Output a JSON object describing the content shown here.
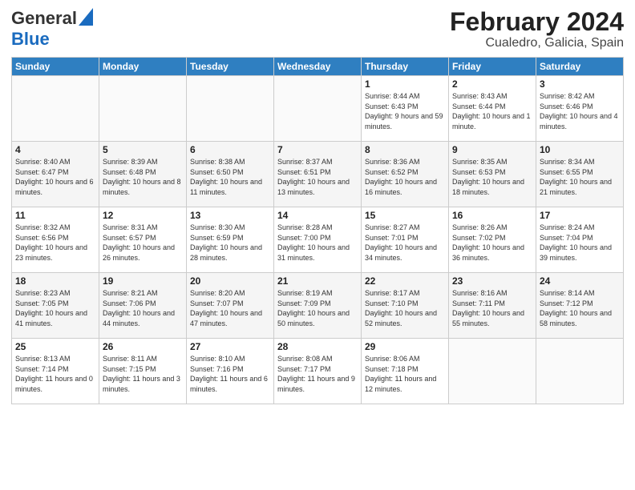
{
  "header": {
    "logo_general": "General",
    "logo_blue": "Blue",
    "month_title": "February 2024",
    "location": "Cualedro, Galicia, Spain"
  },
  "weekdays": [
    "Sunday",
    "Monday",
    "Tuesday",
    "Wednesday",
    "Thursday",
    "Friday",
    "Saturday"
  ],
  "weeks": [
    [
      {
        "day": "",
        "info": ""
      },
      {
        "day": "",
        "info": ""
      },
      {
        "day": "",
        "info": ""
      },
      {
        "day": "",
        "info": ""
      },
      {
        "day": "1",
        "info": "Sunrise: 8:44 AM\nSunset: 6:43 PM\nDaylight: 9 hours and 59 minutes."
      },
      {
        "day": "2",
        "info": "Sunrise: 8:43 AM\nSunset: 6:44 PM\nDaylight: 10 hours and 1 minute."
      },
      {
        "day": "3",
        "info": "Sunrise: 8:42 AM\nSunset: 6:46 PM\nDaylight: 10 hours and 4 minutes."
      }
    ],
    [
      {
        "day": "4",
        "info": "Sunrise: 8:40 AM\nSunset: 6:47 PM\nDaylight: 10 hours and 6 minutes."
      },
      {
        "day": "5",
        "info": "Sunrise: 8:39 AM\nSunset: 6:48 PM\nDaylight: 10 hours and 8 minutes."
      },
      {
        "day": "6",
        "info": "Sunrise: 8:38 AM\nSunset: 6:50 PM\nDaylight: 10 hours and 11 minutes."
      },
      {
        "day": "7",
        "info": "Sunrise: 8:37 AM\nSunset: 6:51 PM\nDaylight: 10 hours and 13 minutes."
      },
      {
        "day": "8",
        "info": "Sunrise: 8:36 AM\nSunset: 6:52 PM\nDaylight: 10 hours and 16 minutes."
      },
      {
        "day": "9",
        "info": "Sunrise: 8:35 AM\nSunset: 6:53 PM\nDaylight: 10 hours and 18 minutes."
      },
      {
        "day": "10",
        "info": "Sunrise: 8:34 AM\nSunset: 6:55 PM\nDaylight: 10 hours and 21 minutes."
      }
    ],
    [
      {
        "day": "11",
        "info": "Sunrise: 8:32 AM\nSunset: 6:56 PM\nDaylight: 10 hours and 23 minutes."
      },
      {
        "day": "12",
        "info": "Sunrise: 8:31 AM\nSunset: 6:57 PM\nDaylight: 10 hours and 26 minutes."
      },
      {
        "day": "13",
        "info": "Sunrise: 8:30 AM\nSunset: 6:59 PM\nDaylight: 10 hours and 28 minutes."
      },
      {
        "day": "14",
        "info": "Sunrise: 8:28 AM\nSunset: 7:00 PM\nDaylight: 10 hours and 31 minutes."
      },
      {
        "day": "15",
        "info": "Sunrise: 8:27 AM\nSunset: 7:01 PM\nDaylight: 10 hours and 34 minutes."
      },
      {
        "day": "16",
        "info": "Sunrise: 8:26 AM\nSunset: 7:02 PM\nDaylight: 10 hours and 36 minutes."
      },
      {
        "day": "17",
        "info": "Sunrise: 8:24 AM\nSunset: 7:04 PM\nDaylight: 10 hours and 39 minutes."
      }
    ],
    [
      {
        "day": "18",
        "info": "Sunrise: 8:23 AM\nSunset: 7:05 PM\nDaylight: 10 hours and 41 minutes."
      },
      {
        "day": "19",
        "info": "Sunrise: 8:21 AM\nSunset: 7:06 PM\nDaylight: 10 hours and 44 minutes."
      },
      {
        "day": "20",
        "info": "Sunrise: 8:20 AM\nSunset: 7:07 PM\nDaylight: 10 hours and 47 minutes."
      },
      {
        "day": "21",
        "info": "Sunrise: 8:19 AM\nSunset: 7:09 PM\nDaylight: 10 hours and 50 minutes."
      },
      {
        "day": "22",
        "info": "Sunrise: 8:17 AM\nSunset: 7:10 PM\nDaylight: 10 hours and 52 minutes."
      },
      {
        "day": "23",
        "info": "Sunrise: 8:16 AM\nSunset: 7:11 PM\nDaylight: 10 hours and 55 minutes."
      },
      {
        "day": "24",
        "info": "Sunrise: 8:14 AM\nSunset: 7:12 PM\nDaylight: 10 hours and 58 minutes."
      }
    ],
    [
      {
        "day": "25",
        "info": "Sunrise: 8:13 AM\nSunset: 7:14 PM\nDaylight: 11 hours and 0 minutes."
      },
      {
        "day": "26",
        "info": "Sunrise: 8:11 AM\nSunset: 7:15 PM\nDaylight: 11 hours and 3 minutes."
      },
      {
        "day": "27",
        "info": "Sunrise: 8:10 AM\nSunset: 7:16 PM\nDaylight: 11 hours and 6 minutes."
      },
      {
        "day": "28",
        "info": "Sunrise: 8:08 AM\nSunset: 7:17 PM\nDaylight: 11 hours and 9 minutes."
      },
      {
        "day": "29",
        "info": "Sunrise: 8:06 AM\nSunset: 7:18 PM\nDaylight: 11 hours and 12 minutes."
      },
      {
        "day": "",
        "info": ""
      },
      {
        "day": "",
        "info": ""
      }
    ]
  ]
}
